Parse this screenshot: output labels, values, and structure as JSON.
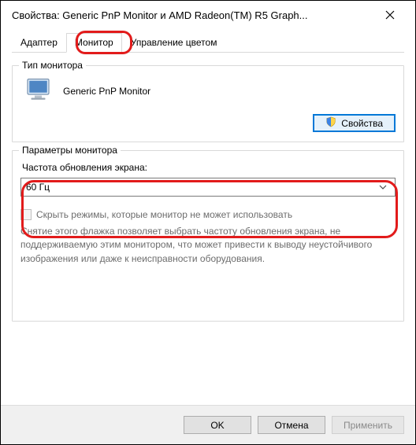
{
  "window": {
    "title": "Свойства: Generic PnP Monitor и AMD Radeon(TM) R5 Graph..."
  },
  "tabs": {
    "adapter": "Адаптер",
    "monitor": "Монитор",
    "color": "Управление цветом"
  },
  "monitorType": {
    "groupLabel": "Тип монитора",
    "name": "Generic PnP Monitor",
    "propertiesBtn": "Свойства"
  },
  "params": {
    "groupLabel": "Параметры монитора",
    "refreshLabel": "Частота обновления экрана:",
    "refreshValue": "60 Гц",
    "hideModesLabel": "Скрыть режимы, которые монитор не может использовать",
    "hideModesHelp": "Снятие этого флажка позволяет выбрать частоту обновления экрана, не поддерживаемую этим монитором, что может привести к выводу неустойчивого изображения или даже к неисправности оборудования."
  },
  "footer": {
    "ok": "OK",
    "cancel": "Отмена",
    "apply": "Применить"
  }
}
